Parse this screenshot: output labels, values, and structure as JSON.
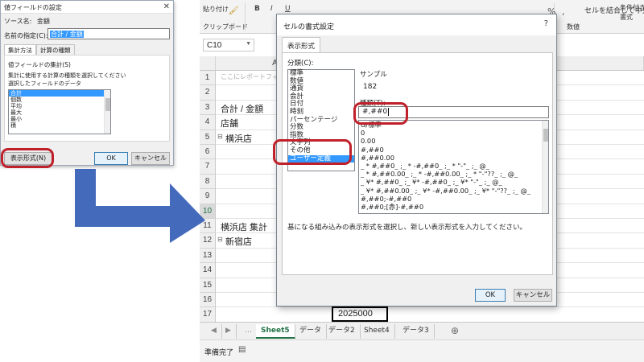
{
  "excel": {
    "ribbon": {
      "paste_label": "貼り付け",
      "clipboard_label": "クリップボード",
      "merge_center_label": "セルを結合して中央揃え",
      "percent_label": "%",
      "comma_label": ",",
      "number_group_label": "数値",
      "conditional_label": "条件付き",
      "conditional_label2": "書式",
      "font_bold": "B",
      "font_italic": "I",
      "font_underline": "U"
    },
    "namebox": "C10",
    "column_a": "A",
    "rows": [
      {
        "num": "1",
        "text": "ここにレポートフィルター"
      },
      {
        "num": "2",
        "text": ""
      },
      {
        "num": "3",
        "text": "合計 / 金額"
      },
      {
        "num": "4",
        "text": "店舗"
      },
      {
        "num": "5",
        "text": "横浜店"
      },
      {
        "num": "6",
        "text": ""
      },
      {
        "num": "7",
        "text": ""
      },
      {
        "num": "8",
        "text": ""
      },
      {
        "num": "9",
        "text": ""
      },
      {
        "num": "10",
        "text": ""
      },
      {
        "num": "11",
        "text": "横浜店 集計"
      },
      {
        "num": "12",
        "text": "新宿店"
      },
      {
        "num": "13",
        "text": ""
      },
      {
        "num": "14",
        "text": ""
      },
      {
        "num": "15",
        "text": ""
      },
      {
        "num": "16",
        "text": ""
      },
      {
        "num": "17",
        "text": ""
      },
      {
        "num": "18",
        "text": "新宿店 集計"
      }
    ],
    "row18_value": "2025000",
    "sheet_tabs": [
      "Sheet5",
      "データ",
      "データ2",
      "Sheet4",
      "データ3"
    ],
    "active_sheet": "Sheet5",
    "status": "準備完了"
  },
  "value_field_dialog": {
    "title": "値フィールドの設定",
    "source_name_label": "ソース名:",
    "source_name": "金額",
    "name_label": "名前の指定(C):",
    "name_value": "合計 / 金額",
    "tabs": [
      "集計方法",
      "計算の種類"
    ],
    "group_label": "値フィールドの集計(S)",
    "desc1": "集計に使用する計算の種類を選択してください",
    "desc2": "選択したフィールドのデータ",
    "functions": [
      "合計",
      "個数",
      "平均",
      "最大",
      "最小",
      "積"
    ],
    "selected_function": "合計",
    "number_format_button": "表示形式(N)",
    "ok": "OK",
    "cancel": "キャンセル"
  },
  "format_cells_dialog": {
    "title": "セルの書式設定",
    "tab": "表示形式",
    "category_label": "分類(C):",
    "categories": [
      "標準",
      "数値",
      "通貨",
      "会計",
      "日付",
      "時刻",
      "パーセンテージ",
      "分数",
      "指数",
      "文字列",
      "その他",
      "ユーザー定義"
    ],
    "selected_category": "ユーザー定義",
    "sample_label": "サンプル",
    "sample_value": "182",
    "type_label": "種類(T):",
    "type_value": "#,##0",
    "format_codes": [
      "G/標準",
      "0",
      "0.00",
      "#,##0",
      "#,##0.00",
      "_ * #,##0_ ;_ * -#,##0_ ;_ * \"-\"_ ;_ @_",
      "_ * #,##0.00_ ;_ * -#,##0.00_ ;_ * \"-\"??_ ;_ @_",
      "_ ¥* #,##0_ ;_ ¥* -#,##0_ ;_ ¥* \"-\"_ ;_ @_",
      "_ ¥* #,##0.00_ ;_ ¥* -#,##0.00_ ;_ ¥* \"-\"??_ ;_ @_",
      "#,##0;-#,##0",
      "#,##0;[赤]-#,##0"
    ],
    "help_text": "基になる組み込みの表示形式を選択し、新しい表示形式を入力してください。",
    "ok": "OK",
    "cancel": "キャンセル"
  },
  "colors": {
    "annotation_red": "#c0202a",
    "arrow_blue": "#3a62b8",
    "excel_green": "#217346",
    "selection_blue": "#3399ff"
  }
}
